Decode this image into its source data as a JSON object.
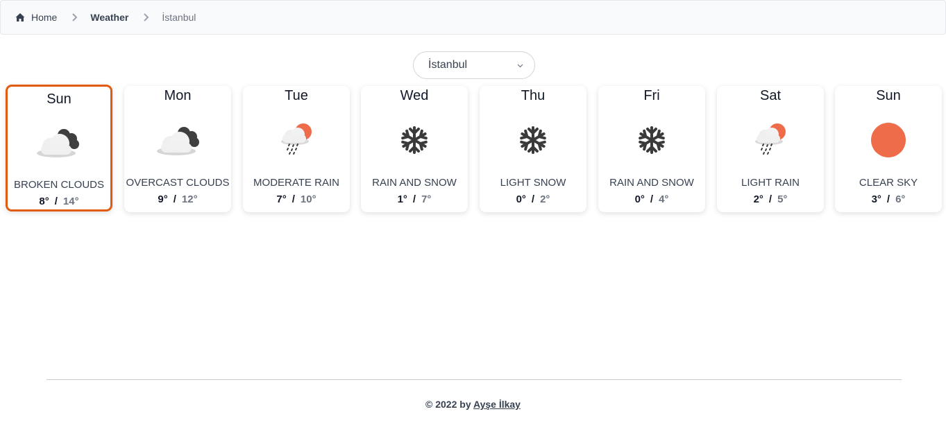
{
  "breadcrumb": {
    "home": "Home",
    "section": "Weather",
    "current": "İstanbul"
  },
  "city_select": {
    "value": "İstanbul"
  },
  "days": [
    {
      "day": "Sun",
      "icon": "broken-clouds-icon",
      "desc": "BROKEN CLOUDS",
      "low": "8°",
      "high": "14°",
      "selected": true
    },
    {
      "day": "Mon",
      "icon": "overcast-clouds-icon",
      "desc": "OVERCAST CLOUDS",
      "low": "9°",
      "high": "12°"
    },
    {
      "day": "Tue",
      "icon": "rain-icon",
      "desc": "MODERATE RAIN",
      "low": "7°",
      "high": "10°"
    },
    {
      "day": "Wed",
      "icon": "snowflake-icon",
      "desc": "RAIN AND SNOW",
      "low": "1°",
      "high": "7°"
    },
    {
      "day": "Thu",
      "icon": "snowflake-icon",
      "desc": "LIGHT SNOW",
      "low": "0°",
      "high": "2°"
    },
    {
      "day": "Fri",
      "icon": "snowflake-icon",
      "desc": "RAIN AND SNOW",
      "low": "0°",
      "high": "4°"
    },
    {
      "day": "Sat",
      "icon": "rain-icon",
      "desc": "LIGHT RAIN",
      "low": "2°",
      "high": "5°"
    },
    {
      "day": "Sun",
      "icon": "sun-icon",
      "desc": "CLEAR SKY",
      "low": "3°",
      "high": "6°"
    }
  ],
  "colors": {
    "selected_border": "#e25b12",
    "sun": "#ef6c4b"
  },
  "footer": {
    "prefix": "© 2022 by",
    "author": "Ayşe İlkay"
  }
}
